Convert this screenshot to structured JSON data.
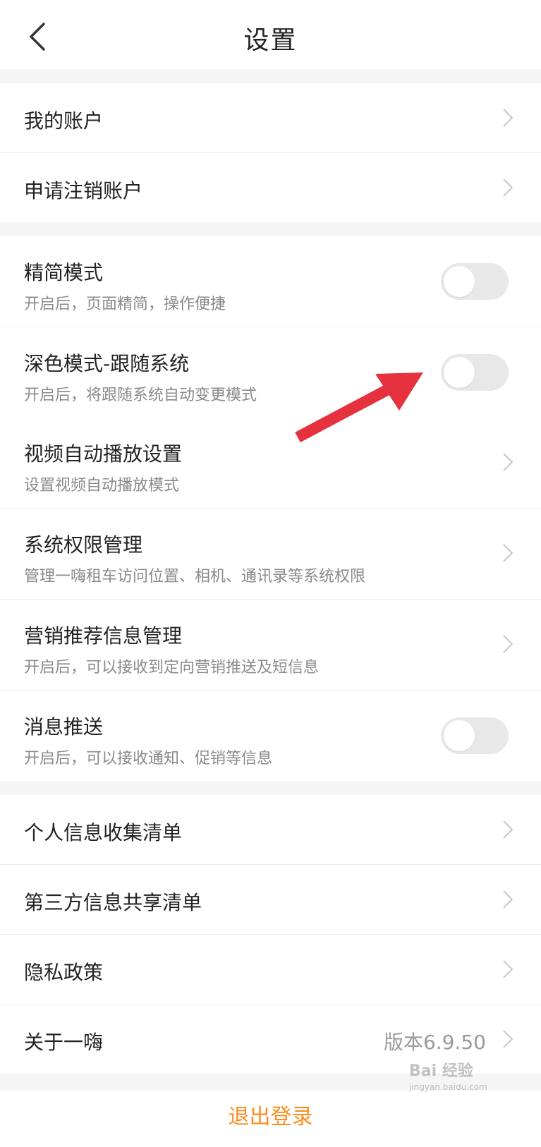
{
  "header": {
    "title": "设置"
  },
  "groups": {
    "account": {
      "items": [
        {
          "label": "我的账户"
        },
        {
          "label": "申请注销账户"
        }
      ]
    },
    "preferences": {
      "items": [
        {
          "label": "精简模式",
          "sub": "开启后，页面精简，操作便捷",
          "toggle_on": false
        },
        {
          "label": "深色模式-跟随系统",
          "sub": "开启后，将跟随系统自动变更模式",
          "toggle_on": false
        },
        {
          "label": "视频自动播放设置",
          "sub": "设置视频自动播放模式"
        },
        {
          "label": "系统权限管理",
          "sub": "管理一嗨租车访问位置、相机、通讯录等系统权限"
        },
        {
          "label": "营销推荐信息管理",
          "sub": "开启后，可以接收到定向营销推送及短信息"
        },
        {
          "label": "消息推送",
          "sub": "开启后，可以接收通知、促销等信息",
          "toggle_on": false
        }
      ]
    },
    "privacy": {
      "items": [
        {
          "label": "个人信息收集清单"
        },
        {
          "label": "第三方信息共享清单"
        },
        {
          "label": "隐私政策"
        },
        {
          "label": "关于一嗨",
          "value": "版本6.9.50"
        }
      ]
    }
  },
  "logout": {
    "label": "退出登录"
  },
  "watermark": {
    "main": "Bai 经验",
    "sub": "jingyan.baidu.com"
  },
  "colors": {
    "accent": "#ff8c1a",
    "annotation_arrow": "#e5323e"
  }
}
